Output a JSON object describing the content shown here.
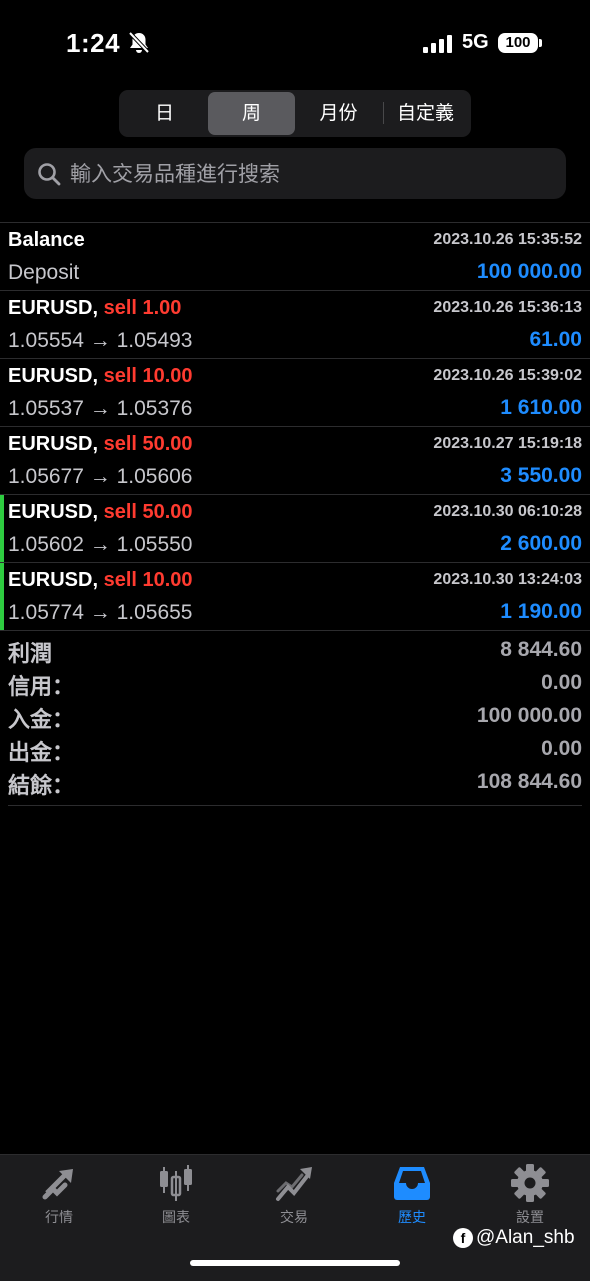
{
  "status_bar": {
    "time": "1:24",
    "network": "5G",
    "battery": "100"
  },
  "segment": {
    "items": [
      "日",
      "周",
      "月份",
      "自定義"
    ],
    "selected": "周"
  },
  "search": {
    "placeholder": "輸入交易品種進行搜索"
  },
  "history": [
    {
      "title": "Balance",
      "side": "",
      "time": "2023.10.26 15:35:52",
      "detail": "Deposit",
      "amount": "100 000.00",
      "marked": false
    },
    {
      "title": "EURUSD,",
      "side": "sell 1.00",
      "time": "2023.10.26 15:36:13",
      "detail": "1.05554 → 1.05493",
      "amount": "61.00",
      "marked": false
    },
    {
      "title": "EURUSD,",
      "side": "sell 10.00",
      "time": "2023.10.26 15:39:02",
      "detail": "1.05537 → 1.05376",
      "amount": "1 610.00",
      "marked": false
    },
    {
      "title": "EURUSD,",
      "side": "sell 50.00",
      "time": "2023.10.27 15:19:18",
      "detail": "1.05677 → 1.05606",
      "amount": "3 550.00",
      "marked": false
    },
    {
      "title": "EURUSD,",
      "side": "sell 50.00",
      "time": "2023.10.30 06:10:28",
      "detail": "1.05602 → 1.05550",
      "amount": "2 600.00",
      "marked": true
    },
    {
      "title": "EURUSD,",
      "side": "sell 10.00",
      "time": "2023.10.30 13:24:03",
      "detail": "1.05774 → 1.05655",
      "amount": "1 190.00",
      "marked": true
    }
  ],
  "summary": [
    {
      "label": "利潤",
      "value": "8 844.60"
    },
    {
      "label": "信用：",
      "value": "0.00"
    },
    {
      "label": "入金：",
      "value": "100 000.00"
    },
    {
      "label": "出金：",
      "value": "0.00"
    },
    {
      "label": "結餘：",
      "value": "108 844.60"
    }
  ],
  "tabbar": {
    "items": [
      {
        "label": "行情",
        "icon": "quotes-arrows-icon"
      },
      {
        "label": "圖表",
        "icon": "candlestick-chart-icon"
      },
      {
        "label": "交易",
        "icon": "trade-trend-icon"
      },
      {
        "label": "歷史",
        "icon": "history-inbox-icon"
      },
      {
        "label": "設置",
        "icon": "gear-icon"
      }
    ],
    "active": "歷史"
  },
  "watermark": {
    "text": "@Alan_shb"
  },
  "colors": {
    "accent": "#1e8cff",
    "sell": "#ff3b30",
    "marker": "#2ecc40",
    "background": "#000000"
  }
}
